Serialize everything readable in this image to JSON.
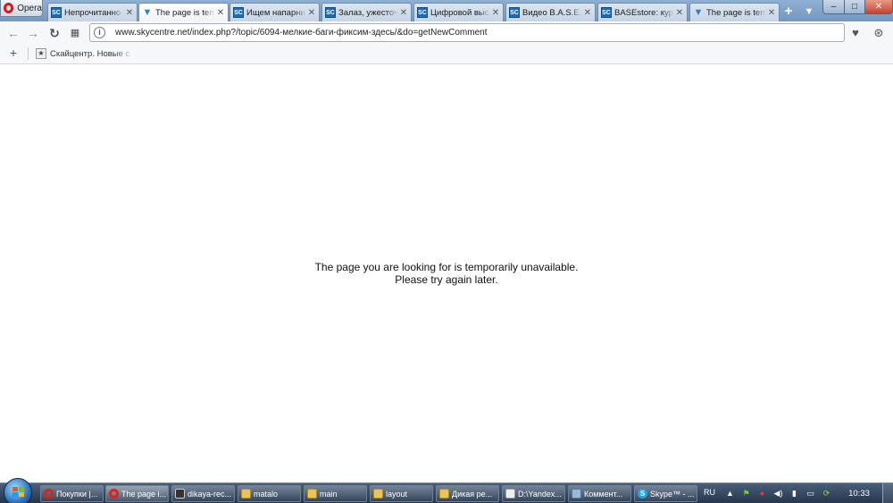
{
  "browser": {
    "menu_label": "Opera",
    "tabs": [
      {
        "label": "Непрочитанно",
        "favicon": "sc-favicon",
        "active": false
      },
      {
        "label": "The page is tem",
        "favicon": "v-favicon",
        "active": true
      },
      {
        "label": "Ищем напарни",
        "favicon": "sc-favicon",
        "active": false
      },
      {
        "label": "Залаз, ужесточ",
        "favicon": "sc-favicon",
        "active": false
      },
      {
        "label": "Цифровой выс",
        "favicon": "sc-favicon",
        "active": false
      },
      {
        "label": "Видео B.A.S.E.",
        "favicon": "sc-favicon",
        "active": false
      },
      {
        "label": "BASEstore: курс",
        "favicon": "sc-favicon",
        "active": false
      },
      {
        "label": "The page is tem",
        "favicon": "v-favicon",
        "active": false
      }
    ],
    "tab_close_glyph": "✕",
    "new_tab_glyph": "+",
    "window_controls": {
      "minimize": "–",
      "maximize": "□",
      "close": "✕"
    }
  },
  "navigation": {
    "url": "www.skycentre.net/index.php?/topic/6094-мелкие-баги-фиксим-здесь/&do=getNewComment",
    "icons": {
      "back": "back-arrow-icon",
      "forward": "forward-arrow-icon",
      "reload": "reload-icon",
      "speed_dial": "speed-dial-icon",
      "info": "info-icon",
      "stash": "heart-icon",
      "menu": "menu-icon"
    }
  },
  "bookmarks": {
    "add_glyph": "+",
    "items": [
      {
        "label": "Скайцентр. Новые с"
      }
    ]
  },
  "page": {
    "message_line1": "The page you are looking for is temporarily unavailable.",
    "message_line2": "Please try again later."
  },
  "taskbar": {
    "items": [
      {
        "label": "Покупки |...",
        "icon": "opera-icon"
      },
      {
        "label": "The page i...",
        "icon": "opera-icon"
      },
      {
        "label": "dikaya-rec...",
        "icon": "image-icon"
      },
      {
        "label": "matalo",
        "icon": "folder-icon"
      },
      {
        "label": "main",
        "icon": "folder-icon"
      },
      {
        "label": "layout",
        "icon": "folder-icon"
      },
      {
        "label": "Дикая ре...",
        "icon": "folder-icon"
      },
      {
        "label": "D:\\Yandex...",
        "icon": "document-icon"
      },
      {
        "label": "Коммент...",
        "icon": "app-icon"
      },
      {
        "label": "Skype™ - ...",
        "icon": "skype-icon"
      }
    ],
    "language": "RU",
    "clock": "10:33"
  }
}
